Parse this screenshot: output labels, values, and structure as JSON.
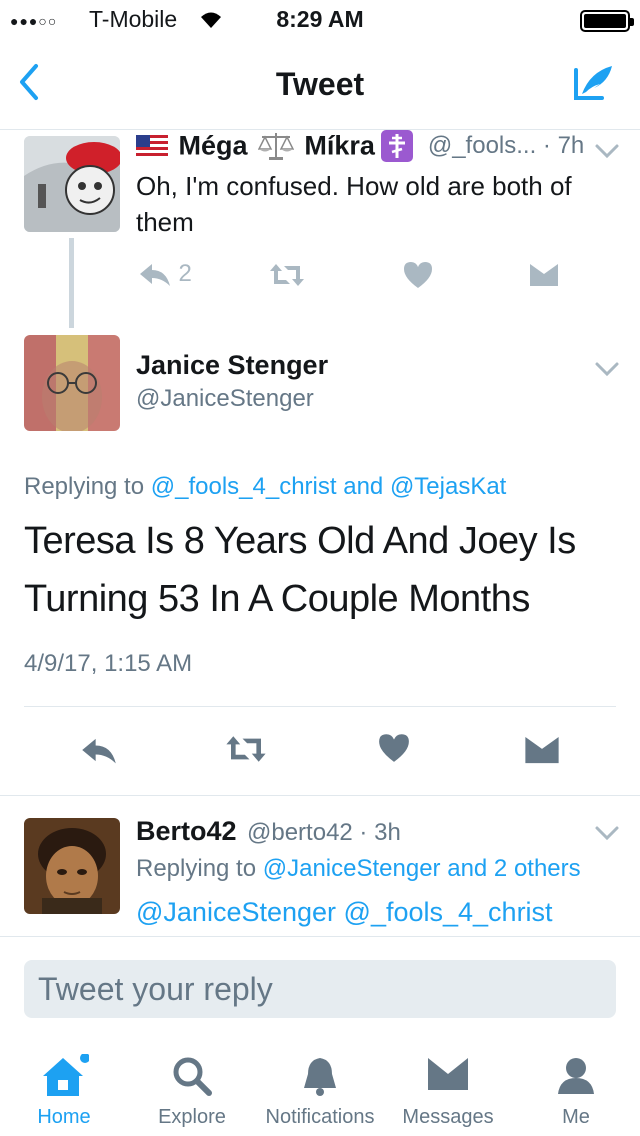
{
  "status_bar": {
    "signal": "●●●○○",
    "carrier": "T-Mobile",
    "time": "8:29 AM"
  },
  "nav": {
    "title": "Tweet"
  },
  "parent_tweet": {
    "name_part1": "Méga",
    "name_part2": "Míkra",
    "handle": "@_fools... · 7h",
    "text": "Oh, I'm confused. How old are both of them",
    "reply_count": "2"
  },
  "main_tweet": {
    "name": "Janice Stenger",
    "handle": "@JaniceStenger",
    "replying_prefix": "Replying to ",
    "replying_user1": "@_fools_4_christ",
    "replying_and": " and ",
    "replying_user2": "@TejasKat",
    "text": "Teresa Is 8 Years Old And Joey Is Turning 53 In A Couple Months",
    "timestamp": "4/9/17, 1:15 AM"
  },
  "reply_tweet": {
    "name": "Berto42",
    "handle": "@berto42 · 3h",
    "replying_prefix": "Replying to ",
    "replying_users": "@JaniceStenger and 2 others",
    "mention1": "@JaniceStenger",
    "mention2": "@_fools_4_christ"
  },
  "reply_box": {
    "placeholder": "Tweet your reply"
  },
  "tabs": [
    {
      "label": "Home",
      "icon": "home-icon",
      "active": true
    },
    {
      "label": "Explore",
      "icon": "search-icon",
      "active": false
    },
    {
      "label": "Notifications",
      "icon": "bell-icon",
      "active": false
    },
    {
      "label": "Messages",
      "icon": "envelope-icon",
      "active": false
    },
    {
      "label": "Me",
      "icon": "person-icon",
      "active": false
    }
  ],
  "colors": {
    "accent": "#1da1f2",
    "muted": "#657786",
    "icon_gray": "#aab8c2",
    "dark_icon": "#657786"
  }
}
